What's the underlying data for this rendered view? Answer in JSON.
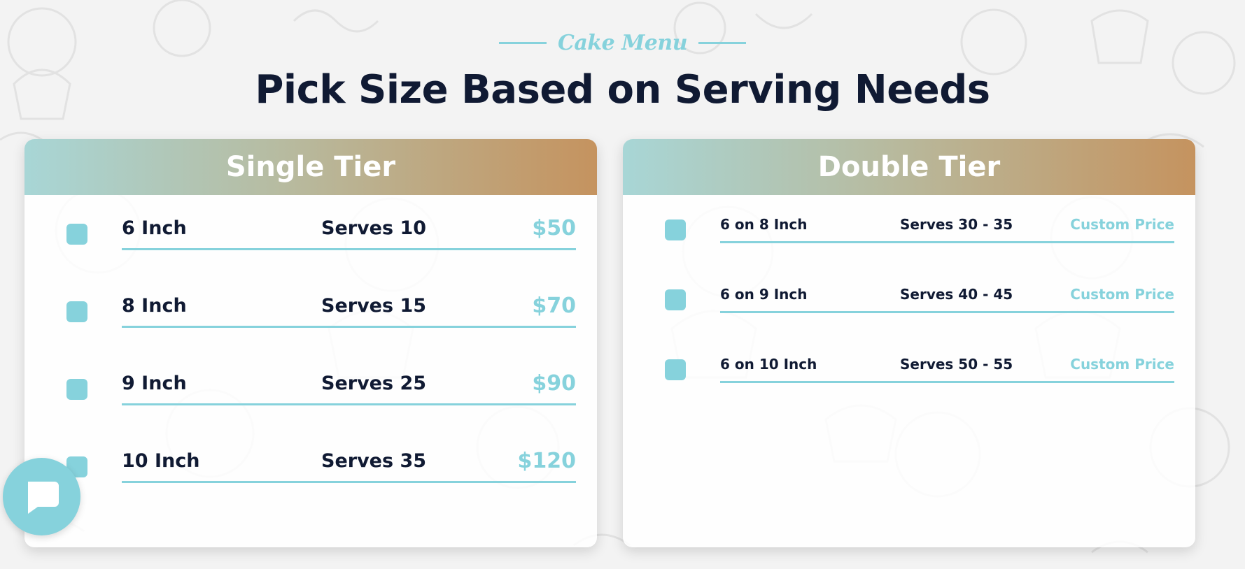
{
  "section": {
    "eyebrow": "Cake Menu",
    "title": "Pick Size Based on Serving Needs"
  },
  "single_tier": {
    "title": "Single Tier",
    "rows": [
      {
        "size": "6 Inch",
        "serves": "Serves 10",
        "price": "$50"
      },
      {
        "size": "8 Inch",
        "serves": "Serves 15",
        "price": "$70"
      },
      {
        "size": "9 Inch",
        "serves": "Serves 25",
        "price": "$90"
      },
      {
        "size": "10 Inch",
        "serves": "Serves 35",
        "price": "$120"
      }
    ]
  },
  "double_tier": {
    "title": "Double Tier",
    "rows": [
      {
        "size": "6 on 8 Inch",
        "serves": "Serves 30 - 35",
        "price": "Custom Price"
      },
      {
        "size": "6 on 9 Inch",
        "serves": "Serves 40 - 45",
        "price": "Custom Price"
      },
      {
        "size": "6 on 10 Inch",
        "serves": "Serves 50 - 55",
        "price": "Custom Price"
      }
    ]
  },
  "chat": {
    "icon": "chat-bubble-icon"
  },
  "colors": {
    "accent": "#86d2dc",
    "heading": "#101a33",
    "gradient_start": "#a8d6d6",
    "gradient_end": "#c5935f"
  }
}
